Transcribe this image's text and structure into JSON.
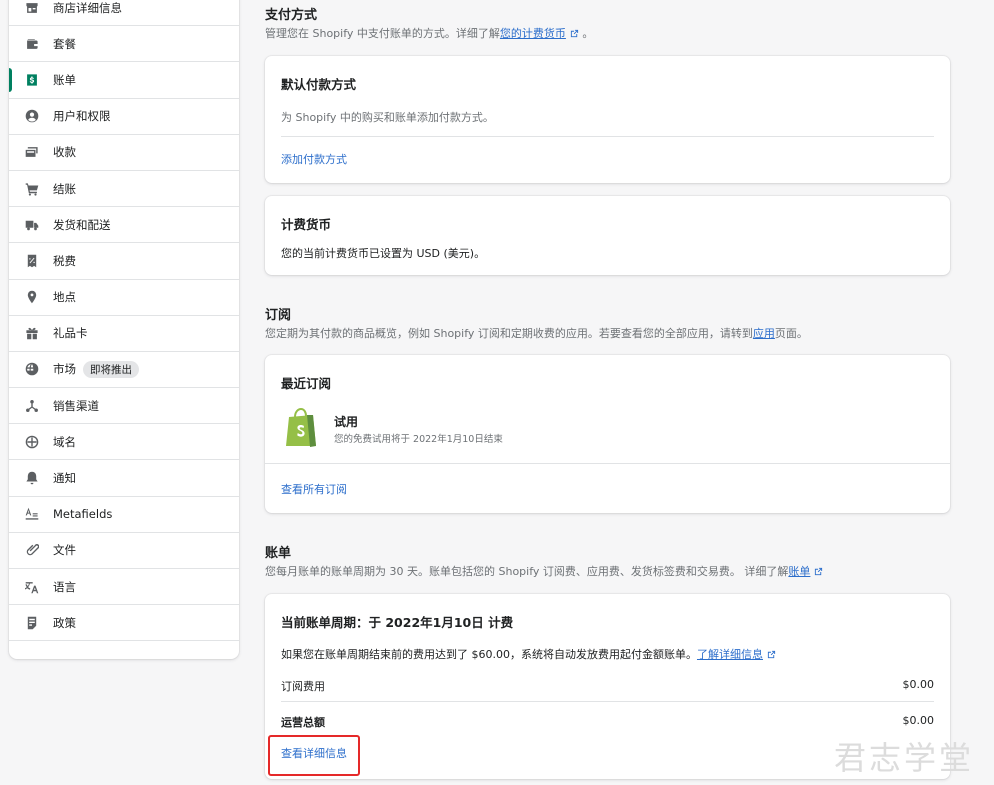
{
  "sidebar": {
    "items": [
      {
        "label": "商店详细信息",
        "icon": "store-icon"
      },
      {
        "label": "套餐",
        "icon": "wallet-icon"
      },
      {
        "label": "账单",
        "icon": "dollar-icon",
        "active": true
      },
      {
        "label": "用户和权限",
        "icon": "user-icon"
      },
      {
        "label": "收款",
        "icon": "credit-card-icon"
      },
      {
        "label": "结账",
        "icon": "cart-icon"
      },
      {
        "label": "发货和配送",
        "icon": "truck-icon"
      },
      {
        "label": "税费",
        "icon": "tax-icon"
      },
      {
        "label": "地点",
        "icon": "location-icon"
      },
      {
        "label": "礼品卡",
        "icon": "gift-icon"
      },
      {
        "label": "市场",
        "icon": "globe-icon",
        "badge": "即将推出"
      },
      {
        "label": "销售渠道",
        "icon": "channels-icon"
      },
      {
        "label": "域名",
        "icon": "globe-grid-icon"
      },
      {
        "label": "通知",
        "icon": "bell-icon"
      },
      {
        "label": "Metafields",
        "icon": "metafields-icon"
      },
      {
        "label": "文件",
        "icon": "paperclip-icon"
      },
      {
        "label": "语言",
        "icon": "translate-icon"
      },
      {
        "label": "政策",
        "icon": "policy-icon"
      }
    ]
  },
  "payment": {
    "title": "支付方式",
    "desc": "管理您在 Shopify 中支付账单的方式。详细了解",
    "desc_link": "您的计费货币",
    "desc_suffix": "。",
    "default_card": {
      "title": "默认付款方式",
      "text": "为 Shopify 中的购买和账单添加付款方式。",
      "link": "添加付款方式"
    },
    "currency_card": {
      "title": "计费货币",
      "text": "您的当前计费货币已设置为 USD (美元)。"
    }
  },
  "subscriptions": {
    "title": "订阅",
    "desc": "您定期为其付款的商品概览，例如 Shopify 订阅和定期收费的应用。若要查看您的全部应用，请转到",
    "desc_link": "应用",
    "desc_suffix": "页面。",
    "card": {
      "title": "最近订阅",
      "plan_name": "试用",
      "plan_detail": "您的免费试用将于 2022年1月10日结束",
      "link": "查看所有订阅"
    }
  },
  "bills": {
    "title": "账单",
    "desc": "您每月账单的账单周期为 30 天。账单包括您的 Shopify 订阅费、应用费、发货标签费和交易费。 详细了解",
    "desc_link": "账单",
    "card": {
      "title": "当前账单周期：于 2022年1月10日 计费",
      "notice": "如果您在账单周期结束前的费用达到了 $60.00，系统将自动发放费用起付金额账单。",
      "notice_link": "了解详细信息",
      "rows": [
        {
          "label": "订阅费用",
          "amount": "$0.00"
        },
        {
          "label": "运营总额",
          "amount": "$0.00"
        }
      ],
      "link": "查看详细信息"
    }
  },
  "watermark": "君志学堂",
  "colors": {
    "accent": "#008060",
    "link": "#2c6ecb",
    "highlight": "#e52929"
  }
}
